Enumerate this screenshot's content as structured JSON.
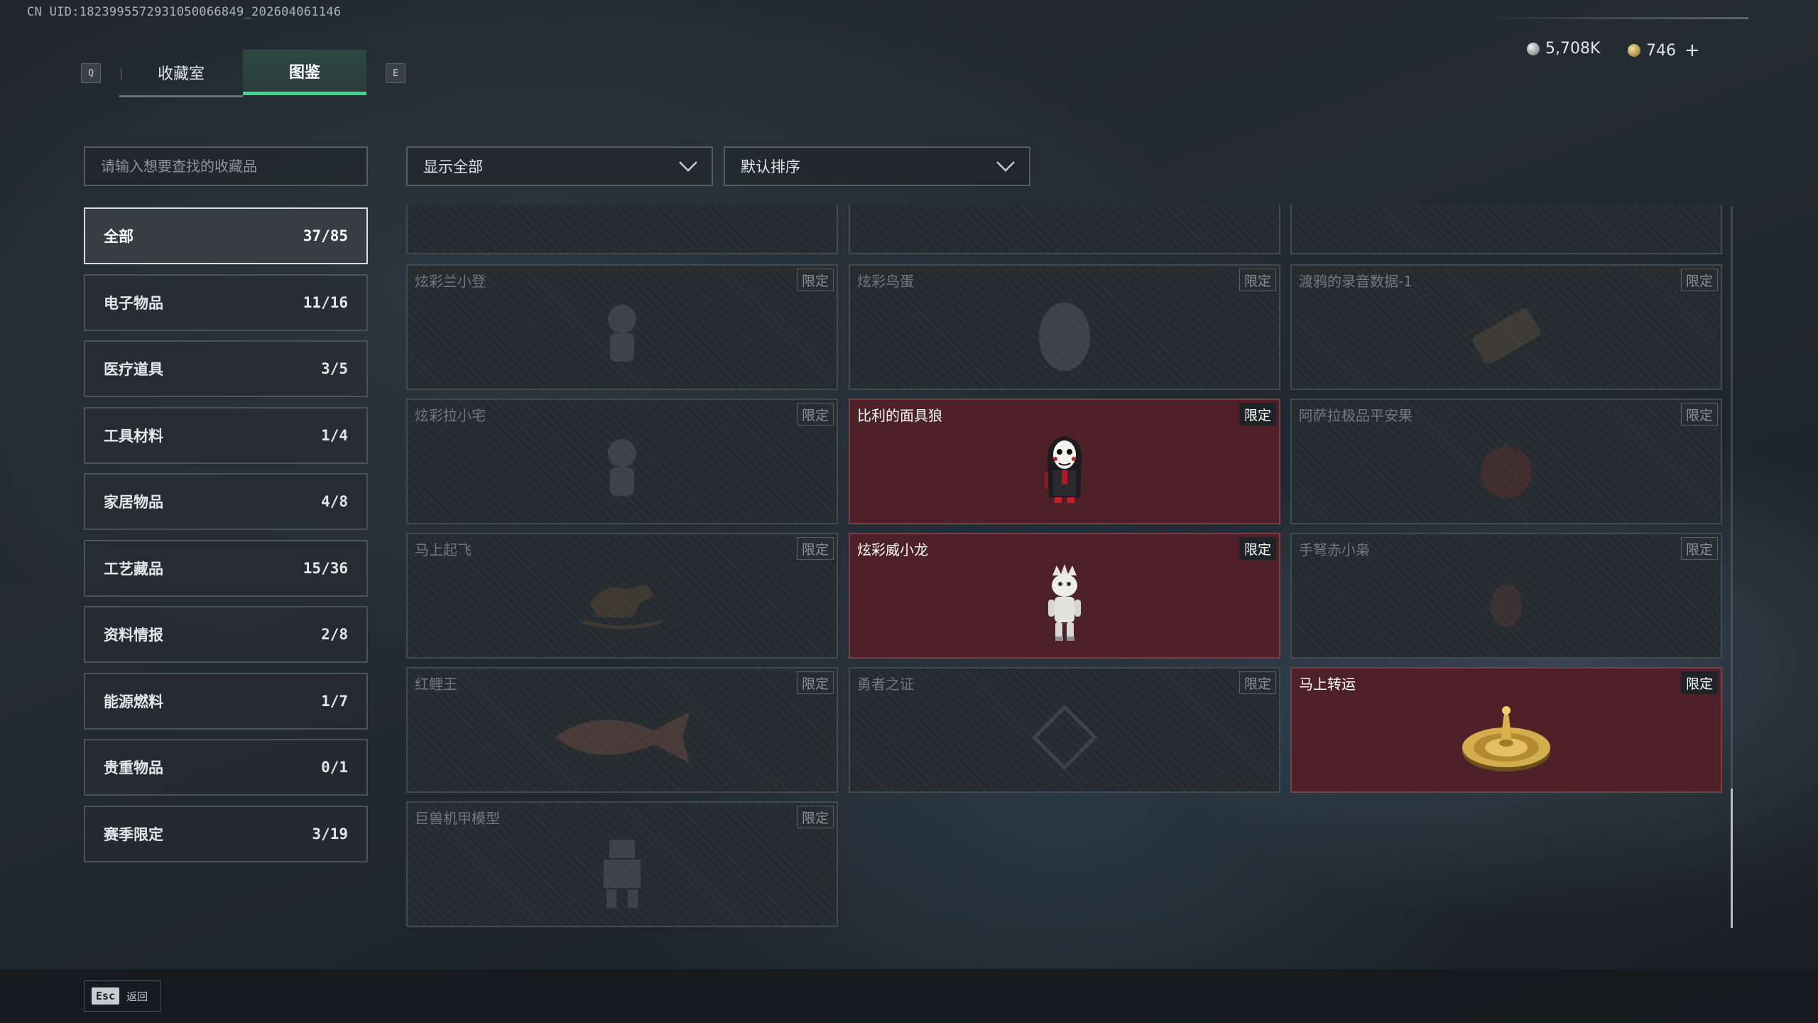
{
  "uid": "CN UID:1823995572931050066849_202604061146",
  "nav": {
    "prev_key": "Q",
    "next_key": "E",
    "tabs": [
      {
        "label": "收藏室"
      },
      {
        "label": "图鉴"
      }
    ]
  },
  "currency": {
    "silver": "5,708K",
    "gold": "746",
    "plus": "+"
  },
  "search": {
    "placeholder": "请输入想要查找的收藏品"
  },
  "filters": {
    "show": "显示全部",
    "sort": "默认排序"
  },
  "categories": [
    {
      "label": "全部",
      "count": "37/85"
    },
    {
      "label": "电子物品",
      "count": "11/16"
    },
    {
      "label": "医疗道具",
      "count": "3/5"
    },
    {
      "label": "工具材料",
      "count": "1/4"
    },
    {
      "label": "家居物品",
      "count": "4/8"
    },
    {
      "label": "工艺藏品",
      "count": "15/36"
    },
    {
      "label": "资料情报",
      "count": "2/8"
    },
    {
      "label": "能源燃料",
      "count": "1/7"
    },
    {
      "label": "贵重物品",
      "count": "0/1"
    },
    {
      "label": "赛季限定",
      "count": "3/19"
    }
  ],
  "items": [
    {
      "name": "炫彩兰小登",
      "tag": "限定",
      "owned": false
    },
    {
      "name": "炫彩鸟蛋",
      "tag": "限定",
      "owned": false
    },
    {
      "name": "渡鸦的录音数据-1",
      "tag": "限定",
      "owned": false
    },
    {
      "name": "炫彩拉小宅",
      "tag": "限定",
      "owned": false
    },
    {
      "name": "比利的面具狼",
      "tag": "限定",
      "owned": true
    },
    {
      "name": "阿萨拉极品平安果",
      "tag": "限定",
      "owned": false
    },
    {
      "name": "马上起飞",
      "tag": "限定",
      "owned": false
    },
    {
      "name": "炫彩威小龙",
      "tag": "限定",
      "owned": true
    },
    {
      "name": "手弩赤小枭",
      "tag": "限定",
      "owned": false
    },
    {
      "name": "红鲤王",
      "tag": "限定",
      "owned": false
    },
    {
      "name": "勇者之证",
      "tag": "限定",
      "owned": false
    },
    {
      "name": "马上转运",
      "tag": "限定",
      "owned": true
    },
    {
      "name": "巨兽机甲模型",
      "tag": "限定",
      "owned": false
    }
  ],
  "footer": {
    "esc_key": "Esc",
    "esc_label": "返回"
  }
}
